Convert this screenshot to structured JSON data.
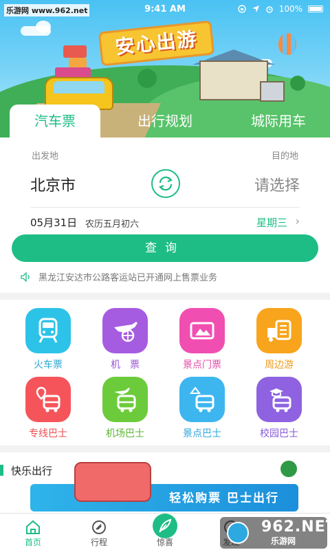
{
  "status_bar": {
    "watermark": "乐游网 www.962.net",
    "time": "9:41 AM",
    "battery": "100%"
  },
  "banner": {
    "slogan": "安心出游"
  },
  "tabs": [
    {
      "label": "汽车票",
      "active": true
    },
    {
      "label": "出行规划",
      "active": false
    },
    {
      "label": "城际用车",
      "active": false
    }
  ],
  "booking": {
    "from_label": "出发地",
    "to_label": "目的地",
    "from_city": "北京市",
    "to_placeholder": "请选择",
    "date": "05月31日",
    "lunar_date": "农历五月初六",
    "weekday": "星期三",
    "query_button": "查询",
    "notice": "黑龙江安达市公路客运站已开通网上售票业务"
  },
  "services": [
    {
      "label": "火车票",
      "icon": "train-icon",
      "color": "#2dc3e8",
      "text_color": "#2aa6d0"
    },
    {
      "label": "机　票",
      "icon": "plane-icon",
      "color": "#a65ce0",
      "text_color": "#9a55d6"
    },
    {
      "label": "景点门票",
      "icon": "ticket-icon",
      "color": "#f04fb1",
      "text_color": "#e04ba6"
    },
    {
      "label": "周边游",
      "icon": "suitcase-icon",
      "color": "#f8a41c",
      "text_color": "#ef9a17"
    },
    {
      "label": "专线巴士",
      "icon": "location-bus-icon",
      "color": "#f5555a",
      "text_color": "#ee4b50"
    },
    {
      "label": "机场巴士",
      "icon": "airport-bus-icon",
      "color": "#6ccb3a",
      "text_color": "#5bb52f"
    },
    {
      "label": "景点巴士",
      "icon": "scenic-bus-icon",
      "color": "#3db6f0",
      "text_color": "#2fa6e0"
    },
    {
      "label": "校园巴士",
      "icon": "campus-bus-icon",
      "color": "#8e62e0",
      "text_color": "#8456d8"
    }
  ],
  "happy_travel": {
    "title": "快乐出行",
    "promo_text": "轻松购票 巴士出行"
  },
  "bottom_nav": [
    {
      "label": "首页",
      "icon": "home-icon",
      "active": true
    },
    {
      "label": "行程",
      "icon": "itinerary-icon",
      "active": false
    },
    {
      "label": "惊喜",
      "icon": "feather-icon",
      "active": false
    },
    {
      "label": "发现",
      "icon": "discover-icon",
      "active": false
    }
  ],
  "watermark_bottom": {
    "big": "962.NET",
    "small": "乐游网"
  },
  "colors": {
    "accent": "#1ebd85"
  }
}
